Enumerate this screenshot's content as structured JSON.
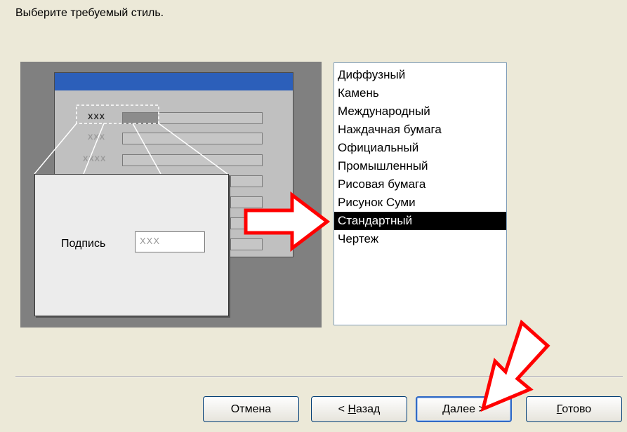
{
  "dialog": {
    "prompt": "Выберите требуемый стиль."
  },
  "preview": {
    "rows": [
      "XXX",
      "XXX",
      "XXXX"
    ],
    "callout_label": "Подпись",
    "callout_value": "XXX"
  },
  "styles": {
    "items": [
      "Диффузный",
      "Камень",
      "Международный",
      "Наждачная бумага",
      "Официальный",
      "Промышленный",
      "Рисовая бумага",
      "Рисунок Суми",
      "Стандартный",
      "Чертеж"
    ],
    "selected": "Стандартный"
  },
  "buttons": {
    "cancel": "Отмена",
    "back_prefix": "< ",
    "back_key": "Н",
    "back_rest": "азад",
    "next_key": "Д",
    "next_rest": "алее >",
    "finish_key": "Г",
    "finish_rest": "отово"
  },
  "colors": {
    "dialog_bg": "#ece9d8",
    "preview_bg": "#808080",
    "preview_titlebar": "#2c5fba",
    "selection": "#000000",
    "annotation_arrow": "#ff0000"
  },
  "icons": [
    "arrow-right-annotation-icon",
    "arrow-down-left-annotation-icon"
  ]
}
